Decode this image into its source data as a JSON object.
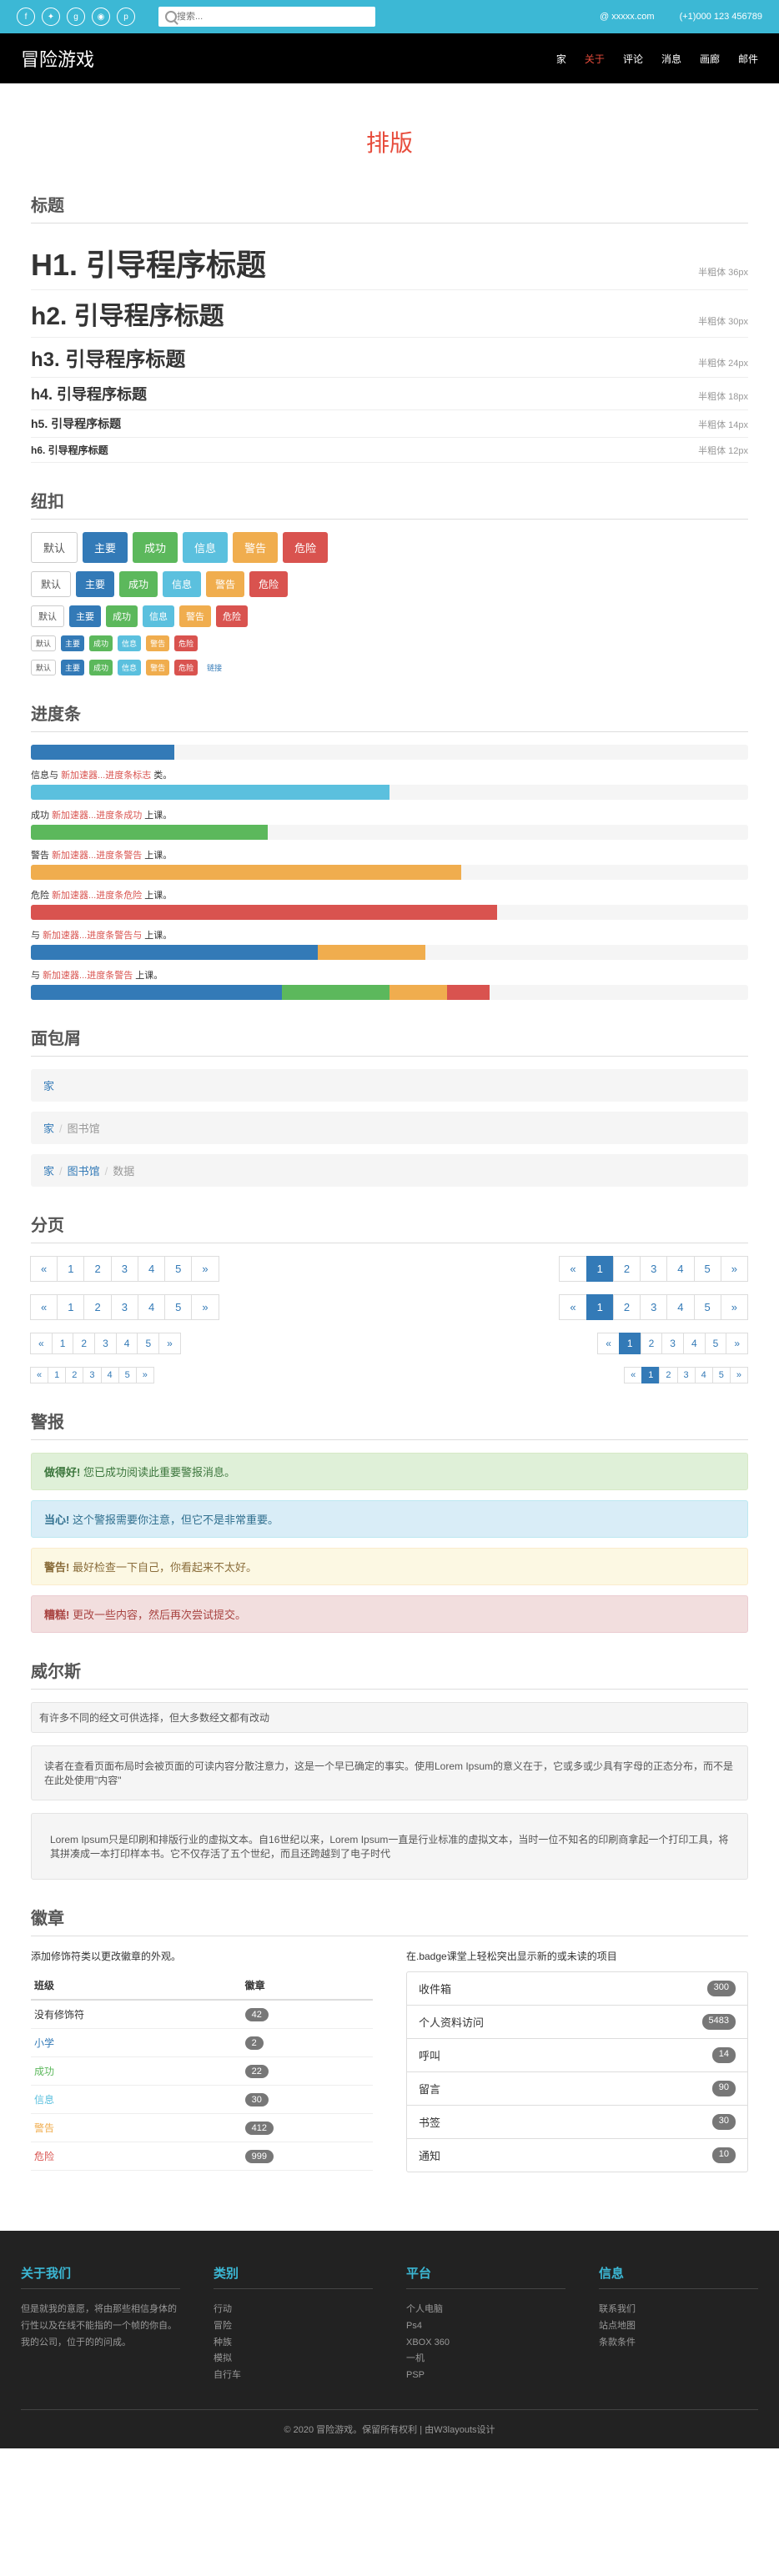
{
  "topbar": {
    "search_placeholder": "搜索...",
    "email": "@ xxxxx.com",
    "phone": "(+1)000 123 456789"
  },
  "nav": {
    "brand": "冒险游戏",
    "links": [
      "家",
      "关于",
      "评论",
      "消息",
      "画廊",
      "邮件"
    ]
  },
  "page_title": "排版",
  "sections": {
    "headings": "标题",
    "buttons": "纽扣",
    "bars": "进度条",
    "breadcrumbs": "面包屑",
    "pagination": "分页",
    "alerts": "警报",
    "wells": "威尔斯",
    "badges": "徽章"
  },
  "headings": [
    {
      "text": "H1. 引导程序标题",
      "label": "半粗体 36px"
    },
    {
      "text": "h2. 引导程序标题",
      "label": "半粗体 30px"
    },
    {
      "text": "h3. 引导程序标题",
      "label": "半粗体 24px"
    },
    {
      "text": "h4. 引导程序标题",
      "label": "半粗体 18px"
    },
    {
      "text": "h5. 引导程序标题",
      "label": "半粗体 14px"
    },
    {
      "text": "h6. 引导程序标题",
      "label": "半粗体 12px"
    }
  ],
  "buttons": [
    "默认",
    "主要",
    "成功",
    "信息",
    "警告",
    "危险",
    "危险"
  ],
  "link_btn": "链接",
  "progress": [
    {
      "label": "信息与 ",
      "link": "新加速器...进度条标志",
      "suffix": " 类。"
    },
    {
      "label": "成功 ",
      "link": "新加速器...进度条成功",
      "suffix": " 上课。"
    },
    {
      "label": "警告 ",
      "link": "新加速器...进度条警告",
      "suffix": " 上课。"
    },
    {
      "label": "危险 ",
      "link": "新加速器...进度条危险",
      "suffix": " 上课。"
    },
    {
      "label": "与 ",
      "link": "新加速器...进度条警告与",
      "suffix": " 上课。"
    },
    {
      "label": "与 ",
      "link": "新加速器...进度条警告",
      "suffix": " 上课。"
    }
  ],
  "crumbs": {
    "home": "家",
    "lib": "图书馆",
    "data": "数据"
  },
  "alerts": {
    "success": {
      "b": "做得好!",
      "t": " 您已成功阅读此重要警报消息。"
    },
    "info": {
      "b": "当心!",
      "t": " 这个警报需要你注意，但它不是非常重要。"
    },
    "warning": {
      "b": "警告!",
      "t": " 最好检查一下自己，你看起来不太好。"
    },
    "danger": {
      "b": "糟糕!",
      "t": " 更改一些内容，然后再次尝试提交。"
    }
  },
  "wells": {
    "a": "有许多不同的经文可供选择，但大多数经文都有改动",
    "b": "读者在查看页面布局时会被页面的可读内容分散注意力，这是一个早已确定的事实。使用Lorem Ipsum的意义在于，它或多或少具有字母的正态分布，而不是在此处使用\"内容\"",
    "c": "Lorem Ipsum只是印刷和排版行业的虚拟文本。自16世纪以来，Lorem Ipsum一直是行业标准的虚拟文本，当时一位不知名的印刷商拿起一个打印工具，将其拼凑成一本打印样本书。它不仅存活了五个世纪，而且还跨越到了电子时代"
  },
  "badges": {
    "intro_left": "添加修饰符类以更改徽章的外观。",
    "intro_right": "在.badge课堂上轻松突出显示新的或未读的项目",
    "th1": "班级",
    "th2": "徽章",
    "rows": [
      {
        "name": "没有修饰符",
        "val": "42"
      },
      {
        "name": "小学",
        "val": "2"
      },
      {
        "name": "成功",
        "val": "22"
      },
      {
        "name": "信息",
        "val": "30"
      },
      {
        "name": "警告",
        "val": "412"
      },
      {
        "name": "危险",
        "val": "999"
      }
    ],
    "list": [
      {
        "name": "收件箱",
        "val": "300"
      },
      {
        "name": "个人资料访问",
        "val": "5483"
      },
      {
        "name": "呼叫",
        "val": "14"
      },
      {
        "name": "留言",
        "val": "90"
      },
      {
        "name": "书签",
        "val": "30"
      },
      {
        "name": "通知",
        "val": "10"
      }
    ]
  },
  "footer": {
    "about": {
      "title": "关于我们",
      "text": "但是就我的意愿，将由那些相信身体的行性以及在线不能指的一个帧的你自。我的公司，位于的的问成。"
    },
    "cat": {
      "title": "类别",
      "items": [
        "行动",
        "冒险",
        "种族",
        "模拟",
        "自行车"
      ]
    },
    "plat": {
      "title": "平台",
      "items": [
        "个人电脑",
        "Ps4",
        "XBOX 360",
        "一机",
        "PSP"
      ]
    },
    "info": {
      "title": "信息",
      "items": [
        "联系我们",
        "站点地图",
        "条款条件"
      ]
    },
    "bottom": "© 2020 冒险游戏。保留所有权利 | 由W3layouts设计"
  }
}
